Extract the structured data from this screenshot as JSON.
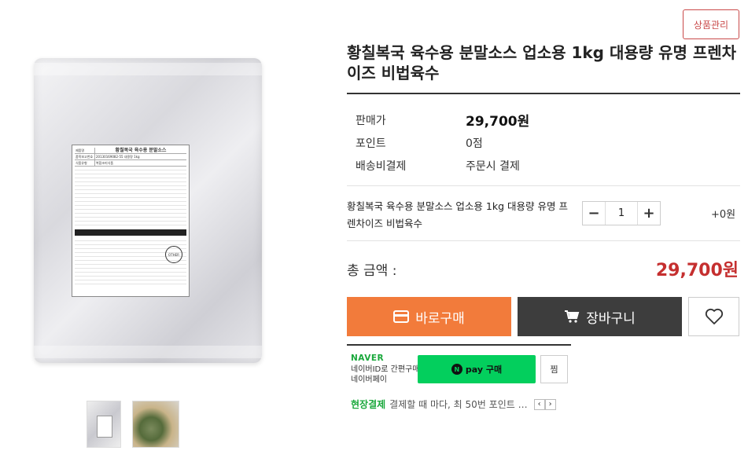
{
  "admin_button": "상품관리",
  "product": {
    "title": "황칠복국 육수용 분말소스 업소용 1kg 대용량 유명 프렌차이즈 비법육수",
    "image_label_title": "황칠복국 육수용 분말소스",
    "image_label_rows": [
      {
        "k": "제품명",
        "v": "황칠복국 육수용 분말소스"
      },
      {
        "k": "품목보고번호",
        "v": "20130169082-55  내용량 1kg"
      },
      {
        "k": "식품유형",
        "v": "복합조미식품"
      }
    ],
    "image_recycle": "OTHER"
  },
  "info": [
    {
      "key": "판매가",
      "value": "29,700원"
    },
    {
      "key": "포인트",
      "value": "0점"
    },
    {
      "key": "배송비결제",
      "value": "주문시 결제"
    }
  ],
  "option": {
    "name": "황칠복국 육수용 분말소스 업소용 1kg 대용량 유명 프렌차이즈 비법육수",
    "quantity": "1",
    "minus": "−",
    "plus": "+",
    "point": "+0원"
  },
  "total": {
    "label": "총 금액 :",
    "value": "29,700원"
  },
  "buttons": {
    "buy": "바로구매",
    "cart": "장바구니"
  },
  "naver_pay": {
    "logo": "NAVER",
    "desc_line1": "네이버ID로 간편구매",
    "desc_line2": "네이버페이",
    "pay_label": "pay 구매",
    "n_mark": "N",
    "zzim": "찜"
  },
  "onsite": {
    "tag": "현장결제",
    "text": "결제할 때 마다, 최 50번 포인트 …",
    "prev": "‹",
    "next": "›"
  },
  "colors": {
    "buy_button": "#f27b3b",
    "cart_button": "#3d3d3d",
    "total_price": "#c52f2f",
    "naver_green": "#03cf5d",
    "admin_border": "#c94a4a"
  },
  "icons": [
    "card-icon",
    "cart-icon",
    "heart-icon",
    "recycle-icon"
  ]
}
